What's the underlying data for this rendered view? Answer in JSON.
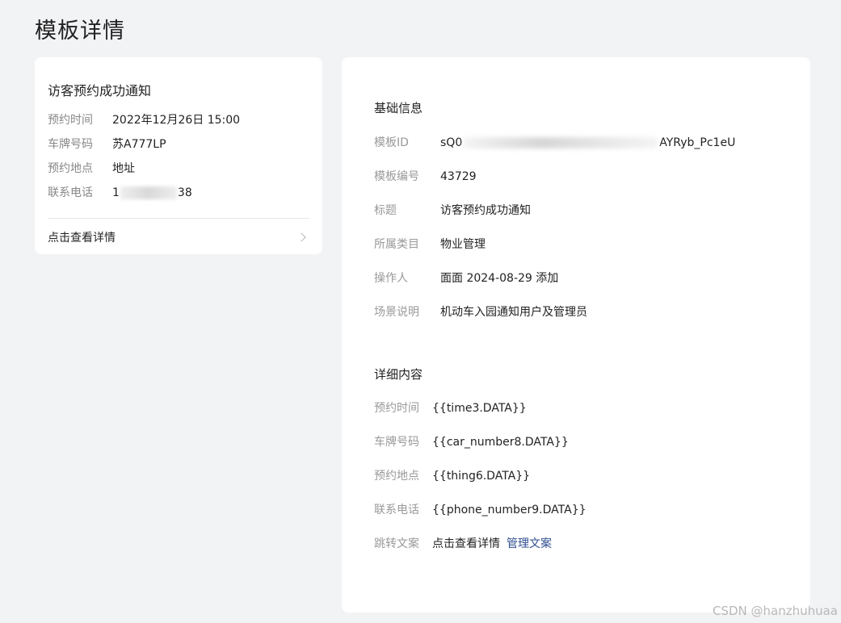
{
  "page": {
    "title": "模板详情"
  },
  "preview": {
    "title": "访客预约成功通知",
    "rows": [
      {
        "label": "预约时间",
        "value": "2022年12月26日 15:00"
      },
      {
        "label": "车牌号码",
        "value": "苏A777LP"
      },
      {
        "label": "预约地点",
        "value": "地址"
      },
      {
        "label": "联系电话",
        "value_prefix": "1",
        "value_suffix": "38"
      }
    ],
    "link_label": "点击查看详情"
  },
  "basic_info": {
    "title": "基础信息",
    "template_id": {
      "label": "模板ID",
      "prefix": "sQ0",
      "suffix": "AYRyb_Pc1eU"
    },
    "template_no": {
      "label": "模板编号",
      "value": "43729"
    },
    "subject": {
      "label": "标题",
      "value": "访客预约成功通知"
    },
    "category": {
      "label": "所属类目",
      "value": "物业管理"
    },
    "operator": {
      "label": "操作人",
      "value": "面面 2024-08-29 添加"
    },
    "scene": {
      "label": "场景说明",
      "value": "机动车入园通知用户及管理员"
    }
  },
  "detail_content": {
    "title": "详细内容",
    "rows": [
      {
        "label": "预约时间",
        "value": "{{time3.DATA}}"
      },
      {
        "label": "车牌号码",
        "value": "{{car_number8.DATA}}"
      },
      {
        "label": "预约地点",
        "value": "{{thing6.DATA}}"
      },
      {
        "label": "联系电话",
        "value": "{{phone_number9.DATA}}"
      }
    ],
    "jump": {
      "label": "跳转文案",
      "value": "点击查看详情",
      "link": "管理文案"
    }
  },
  "watermark": "CSDN @hanzhuhuaa"
}
